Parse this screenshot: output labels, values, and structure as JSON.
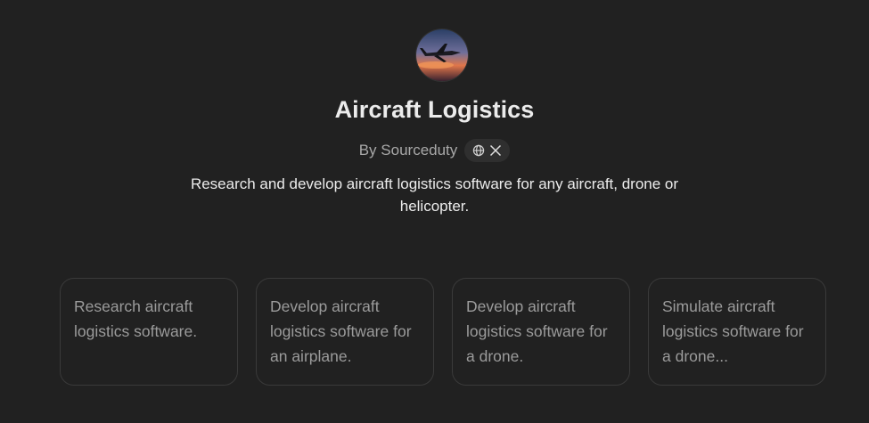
{
  "gpt": {
    "title": "Aircraft Logistics",
    "author": "By Sourceduty",
    "description": "Research and develop aircraft logistics software for any aircraft, drone or helicopter."
  },
  "icons": {
    "avatar": "jet-at-sunset-avatar",
    "website": "globe-icon",
    "social": "x-logo-icon"
  },
  "starters": [
    {
      "label": "Research aircraft logistics software."
    },
    {
      "label": "Develop aircraft logistics software for an airplane."
    },
    {
      "label": "Develop aircraft logistics software for a drone."
    },
    {
      "label": "Simulate aircraft logistics software for a drone..."
    }
  ],
  "colors": {
    "background": "#212121",
    "card_border": "#3a3a3a",
    "pill_background": "#2f2f2f",
    "primary_text": "#ececec",
    "muted_text": "#9b9b9b"
  }
}
